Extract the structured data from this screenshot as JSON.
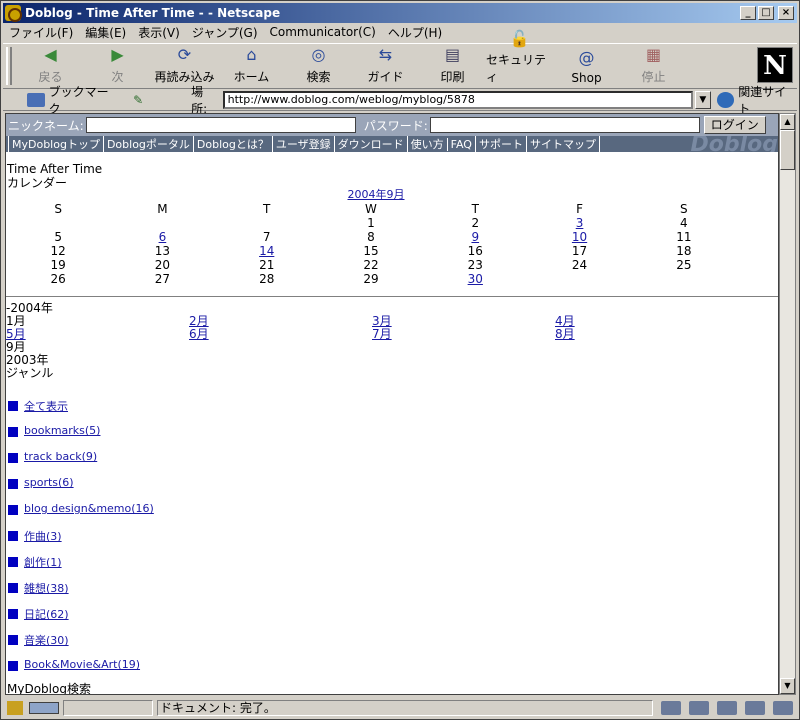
{
  "window": {
    "title": "Doblog - Time After Time - - Netscape"
  },
  "menu": [
    "ファイル(F)",
    "編集(E)",
    "表示(V)",
    "ジャンプ(G)",
    "Communicator(C)",
    "ヘルプ(H)"
  ],
  "toolbar": {
    "back": "戻る",
    "forward": "次",
    "reload": "再読み込み",
    "home": "ホーム",
    "search": "検索",
    "guide": "ガイド",
    "print": "印刷",
    "security": "セキュリティ",
    "shop": "Shop",
    "stop": "停止"
  },
  "location": {
    "bookmarks": "ブックマーク",
    "label": "場所:",
    "url": "http://www.doblog.com/weblog/myblog/5878",
    "related": "関連サイト"
  },
  "login": {
    "nickname_label": "ニックネーム:",
    "password_label": "パスワード:",
    "button": "ログイン"
  },
  "nav": [
    "MyDoblogトップ",
    "Doblogポータル",
    "Doblogとは？",
    "ユーザ登録",
    "ダウンロード",
    "使い方",
    "FAQ",
    "サポート",
    "サイトマップ"
  ],
  "nav_brand": "Doblog",
  "blog": {
    "title": "Time After Time",
    "calendar_label": "カレンダー"
  },
  "calendar": {
    "month": "2004年9月",
    "weekdays": [
      "S",
      "M",
      "T",
      "W",
      "T",
      "F",
      "S"
    ],
    "weeks": [
      [
        "",
        "",
        "",
        "1",
        "2",
        "3",
        "4"
      ],
      [
        "5",
        "6",
        "7",
        "8",
        "9",
        "10",
        "11"
      ],
      [
        "12",
        "13",
        "14",
        "15",
        "16",
        "17",
        "18"
      ],
      [
        "19",
        "20",
        "21",
        "22",
        "23",
        "24",
        "25"
      ],
      [
        "26",
        "27",
        "28",
        "29",
        "30",
        "",
        ""
      ]
    ],
    "linked_days": [
      "3",
      "6",
      "9",
      "10",
      "14",
      "30"
    ]
  },
  "archive": {
    "year_2004": "-2004年",
    "months_rows": [
      [
        "1月",
        "2月",
        "3月",
        "4月"
      ],
      [
        "5月",
        "6月",
        "7月",
        "8月"
      ],
      [
        "9月",
        "",
        "",
        ""
      ]
    ],
    "plain_months": [
      "1月",
      "9月"
    ],
    "year_2003": " 2003年",
    "genre_label": "ジャンル"
  },
  "genres": [
    "全て表示",
    "bookmarks(5)",
    "track back(9)",
    "sports(6)",
    "blog design&memo(16)",
    "作曲(3)",
    "創作(1)",
    "雑想(38)",
    "日記(62)",
    "音楽(30)",
    "Book&Movie&Art(19)"
  ],
  "search_label": "MyDoblog検索",
  "status": {
    "text": "ドキュメント: 完了。"
  }
}
